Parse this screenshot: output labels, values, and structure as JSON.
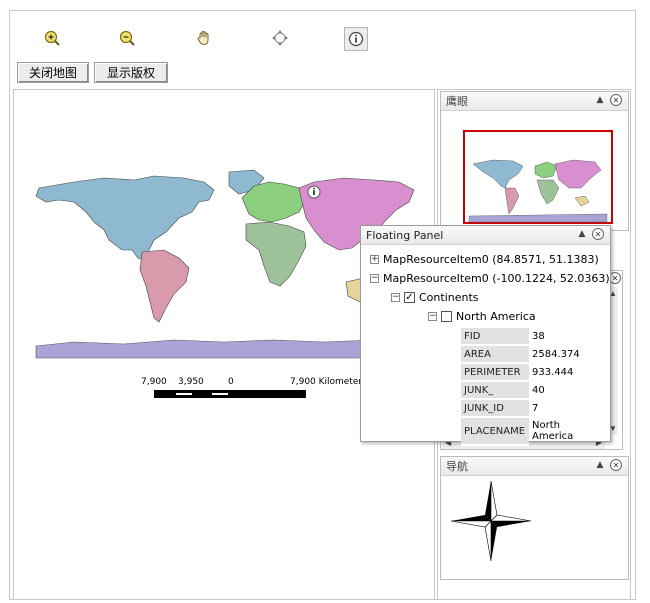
{
  "toolbar": {
    "tools": [
      {
        "name": "zoom-in-icon"
      },
      {
        "name": "zoom-out-icon"
      },
      {
        "name": "pan-hand-icon"
      },
      {
        "name": "full-extent-icon"
      },
      {
        "name": "identify-icon"
      }
    ],
    "close_map_label": "关闭地图",
    "show_copyright_label": "显示版权"
  },
  "scale_bar": {
    "labels": [
      "7,900",
      "3,950",
      "0",
      "7,900 Kilometers"
    ]
  },
  "overview_panel": {
    "title": "鹰眼"
  },
  "navigation_panel": {
    "title": "导航"
  },
  "floating_panel": {
    "title": "Floating Panel",
    "items": [
      {
        "label": "MapResourceItem0 (84.8571, 51.1383)",
        "expander": "+"
      },
      {
        "label": "MapResourceItem0 (-100.1224, 52.0363)",
        "expander": "−"
      }
    ],
    "layer": {
      "label": "Continents",
      "checked": true,
      "expander": "−",
      "check_mark": "✓"
    },
    "feature": {
      "label": "North America",
      "checked": false,
      "expander": "−"
    },
    "attributes": [
      {
        "key": "FID",
        "value": "38"
      },
      {
        "key": "AREA",
        "value": "2584.374"
      },
      {
        "key": "PERIMETER",
        "value": "933.444"
      },
      {
        "key": "JUNK_",
        "value": "40"
      },
      {
        "key": "JUNK_ID",
        "value": "7"
      },
      {
        "key": "PLACENAME",
        "value": "North America"
      }
    ]
  },
  "colors": {
    "north_america": "#8fb9d0",
    "south_america": "#d99aab",
    "europe": "#8ccf7e",
    "asia": "#d98fcf",
    "africa": "#9dc29a",
    "australia": "#e6d49a",
    "antarctica": "#a9a3d6",
    "overview_border": "#cc0000"
  }
}
